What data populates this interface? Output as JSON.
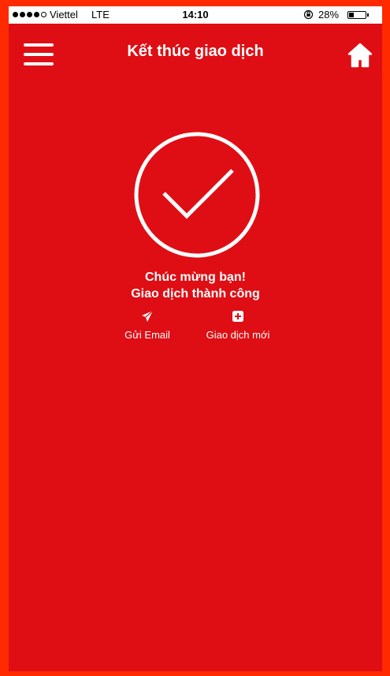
{
  "status_bar": {
    "carrier": "Viettel",
    "network": "LTE",
    "time": "14:10",
    "battery_percent": "28%",
    "battery_level": 0.28,
    "signal_bars_filled": 4,
    "signal_bars_total": 5
  },
  "header": {
    "title": "Kết thúc giao dịch",
    "menu_icon": "hamburger-menu-icon",
    "home_icon": "home-icon"
  },
  "result": {
    "icon": "checkmark-circle-icon",
    "line1": "Chúc mừng bạn!",
    "line2": "Giao dịch thành công"
  },
  "actions": {
    "send_email": {
      "label": "Gửi Email",
      "icon": "paper-plane-icon"
    },
    "new_transaction": {
      "label": "Giao dịch mới",
      "icon": "plus-square-icon"
    }
  },
  "colors": {
    "background": "#df0e14",
    "frame": "#ff2a00",
    "foreground": "#ffffff"
  }
}
